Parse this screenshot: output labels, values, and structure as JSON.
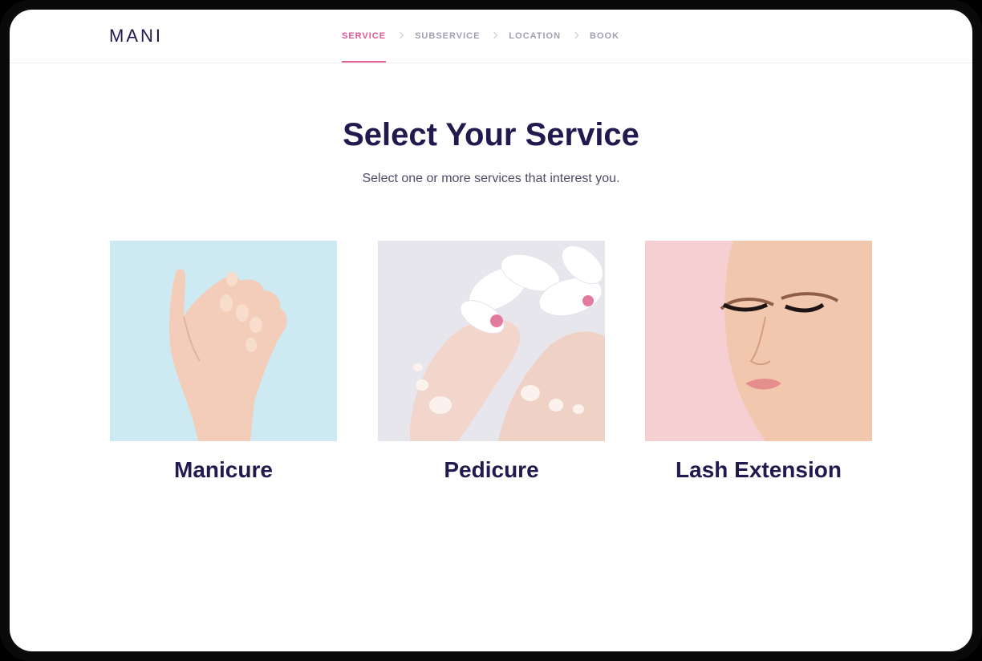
{
  "header": {
    "logo": "MANI",
    "steps": [
      {
        "label": "SERVICE",
        "active": true
      },
      {
        "label": "SUBSERVICE",
        "active": false
      },
      {
        "label": "LOCATION",
        "active": false
      },
      {
        "label": "BOOK",
        "active": false
      }
    ]
  },
  "main": {
    "title": "Select Your Service",
    "subtitle": "Select one or more services that interest you."
  },
  "services": [
    {
      "label": "Manicure",
      "image": "hand-photo"
    },
    {
      "label": "Pedicure",
      "image": "feet-flowers-photo"
    },
    {
      "label": "Lash Extension",
      "image": "woman-face-photo"
    }
  ],
  "colors": {
    "brand": "#22194f",
    "accent": "#e0578f",
    "muted": "#a29fb0"
  }
}
